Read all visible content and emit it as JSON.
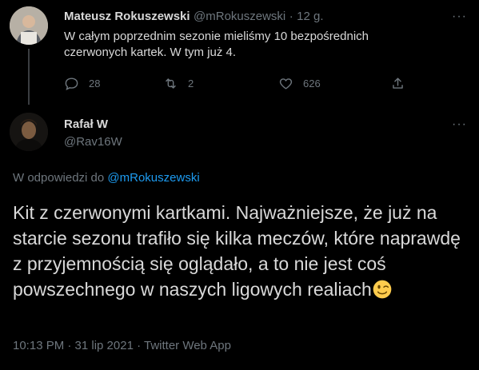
{
  "tweet1": {
    "name": "Mateusz Rokuszewski",
    "handle": "@mRokuszewski",
    "separator": "·",
    "time": "12 g.",
    "text_line1": "W całym poprzednim sezonie mieliśmy 10 bezpośrednich",
    "text_line2": "czerwonych kartek. W tym już 4.",
    "replies": "28",
    "retweets": "2",
    "likes": "626"
  },
  "tweet2": {
    "name": "Rafał W",
    "handle": "@Rav16W",
    "reply_prefix": "W odpowiedzi do ",
    "reply_handle": "@mRokuszewski",
    "text": "Kit z czerwonymi kartkami. Najważniejsze, że już na starcie sezonu trafiło się kilka meczów, które naprawdę z przyjemnością się oglądało, a to nie jest coś powszechnego w naszych ligowych realiach",
    "emoji": "winking-face",
    "footer": "10:13 PM · 31 lip 2021 · Twitter Web App"
  },
  "colors": {
    "background": "#000000",
    "text": "#d9d9d9",
    "muted": "#6e767d",
    "link": "#1d9bf0"
  }
}
